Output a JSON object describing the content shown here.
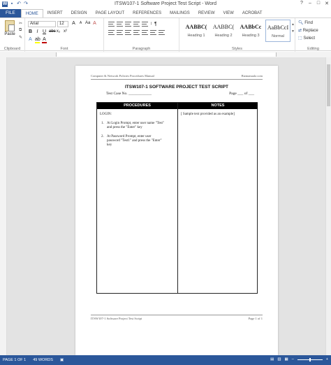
{
  "window": {
    "title": "ITSW107-1 Software Project Test Script - Word"
  },
  "qat": {
    "icons": [
      "word-icon",
      "save-icon",
      "undo-icon",
      "redo-icon"
    ]
  },
  "controls": {
    "help": "?",
    "minimize": "–",
    "maximize": "□",
    "close": "✕"
  },
  "tabs": {
    "file": "FILE",
    "items": [
      "HOME",
      "INSERT",
      "DESIGN",
      "PAGE LAYOUT",
      "REFERENCES",
      "MAILINGS",
      "REVIEW",
      "VIEW",
      "ACROBAT"
    ],
    "active": "HOME"
  },
  "ribbon": {
    "clipboard": {
      "paste": "Paste",
      "label": "Clipboard"
    },
    "font": {
      "name": "Arial",
      "size": "12",
      "label": "Font"
    },
    "paragraph": {
      "label": "Paragraph"
    },
    "styles": {
      "items": [
        {
          "preview": "AABBC(",
          "name": "Heading 1"
        },
        {
          "preview": "AABBC(",
          "name": "Heading 2"
        },
        {
          "preview": "AABbCc",
          "name": "Heading 3"
        },
        {
          "preview": "AaBbCcI",
          "name": "Normal"
        }
      ],
      "label": "Styles"
    },
    "editing": {
      "find": "Find",
      "replace": "Replace",
      "select": "Select",
      "label": "Editing"
    }
  },
  "document": {
    "header_left": "Computer & Network Policies Procedures Manual",
    "header_right": "Bizmanualz.com",
    "title": "ITSW107-1   SOFTWARE PROJECT TEST SCRIPT",
    "test_case": "Test Case No. ____________",
    "page_of": "Page ___ of ___",
    "table": {
      "headers": [
        "PROCEDURES",
        "NOTES"
      ],
      "login_label": "LOGIN:",
      "steps": [
        {
          "num": "1.",
          "text": "At Login Prompt, enter user name \"Test\" and press the \"Enter\" key"
        },
        {
          "num": "2.",
          "text": "At Password Prompt, enter user password \"Test1\" and press the \"Enter\" key"
        }
      ],
      "notes": "[ Sample text provided as an example]"
    },
    "footer_left": "ITSW107-1 Software Project Test Script",
    "footer_right": "Page 1 of 1"
  },
  "status": {
    "page": "PAGE 1 OF 1",
    "words": "49 WORDS",
    "zoom": "–"
  }
}
